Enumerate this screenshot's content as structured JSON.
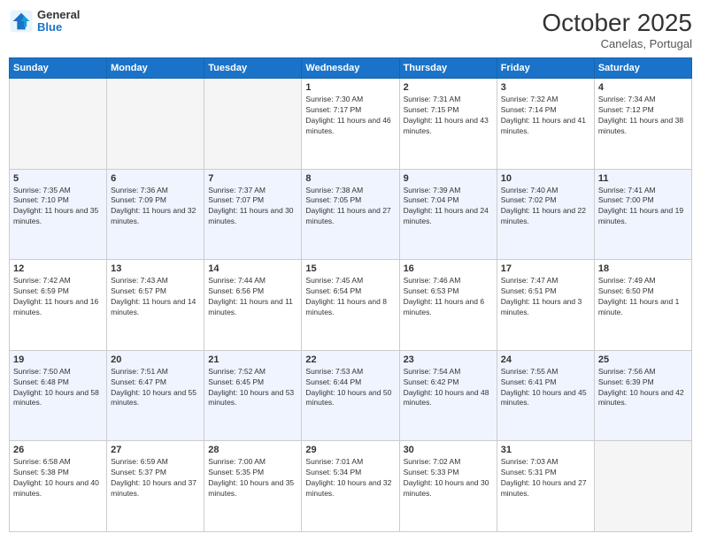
{
  "header": {
    "logo": {
      "general": "General",
      "blue": "Blue"
    },
    "title": "October 2025",
    "subtitle": "Canelas, Portugal"
  },
  "days_of_week": [
    "Sunday",
    "Monday",
    "Tuesday",
    "Wednesday",
    "Thursday",
    "Friday",
    "Saturday"
  ],
  "weeks": [
    [
      {
        "day": "",
        "empty": true
      },
      {
        "day": "",
        "empty": true
      },
      {
        "day": "",
        "empty": true
      },
      {
        "day": "1",
        "sunrise": "7:30 AM",
        "sunset": "7:17 PM",
        "daylight": "11 hours and 46 minutes."
      },
      {
        "day": "2",
        "sunrise": "7:31 AM",
        "sunset": "7:15 PM",
        "daylight": "11 hours and 43 minutes."
      },
      {
        "day": "3",
        "sunrise": "7:32 AM",
        "sunset": "7:14 PM",
        "daylight": "11 hours and 41 minutes."
      },
      {
        "day": "4",
        "sunrise": "7:34 AM",
        "sunset": "7:12 PM",
        "daylight": "11 hours and 38 minutes."
      }
    ],
    [
      {
        "day": "5",
        "sunrise": "7:35 AM",
        "sunset": "7:10 PM",
        "daylight": "11 hours and 35 minutes."
      },
      {
        "day": "6",
        "sunrise": "7:36 AM",
        "sunset": "7:09 PM",
        "daylight": "11 hours and 32 minutes."
      },
      {
        "day": "7",
        "sunrise": "7:37 AM",
        "sunset": "7:07 PM",
        "daylight": "11 hours and 30 minutes."
      },
      {
        "day": "8",
        "sunrise": "7:38 AM",
        "sunset": "7:05 PM",
        "daylight": "11 hours and 27 minutes."
      },
      {
        "day": "9",
        "sunrise": "7:39 AM",
        "sunset": "7:04 PM",
        "daylight": "11 hours and 24 minutes."
      },
      {
        "day": "10",
        "sunrise": "7:40 AM",
        "sunset": "7:02 PM",
        "daylight": "11 hours and 22 minutes."
      },
      {
        "day": "11",
        "sunrise": "7:41 AM",
        "sunset": "7:00 PM",
        "daylight": "11 hours and 19 minutes."
      }
    ],
    [
      {
        "day": "12",
        "sunrise": "7:42 AM",
        "sunset": "6:59 PM",
        "daylight": "11 hours and 16 minutes."
      },
      {
        "day": "13",
        "sunrise": "7:43 AM",
        "sunset": "6:57 PM",
        "daylight": "11 hours and 14 minutes."
      },
      {
        "day": "14",
        "sunrise": "7:44 AM",
        "sunset": "6:56 PM",
        "daylight": "11 hours and 11 minutes."
      },
      {
        "day": "15",
        "sunrise": "7:45 AM",
        "sunset": "6:54 PM",
        "daylight": "11 hours and 8 minutes."
      },
      {
        "day": "16",
        "sunrise": "7:46 AM",
        "sunset": "6:53 PM",
        "daylight": "11 hours and 6 minutes."
      },
      {
        "day": "17",
        "sunrise": "7:47 AM",
        "sunset": "6:51 PM",
        "daylight": "11 hours and 3 minutes."
      },
      {
        "day": "18",
        "sunrise": "7:49 AM",
        "sunset": "6:50 PM",
        "daylight": "11 hours and 1 minute."
      }
    ],
    [
      {
        "day": "19",
        "sunrise": "7:50 AM",
        "sunset": "6:48 PM",
        "daylight": "10 hours and 58 minutes."
      },
      {
        "day": "20",
        "sunrise": "7:51 AM",
        "sunset": "6:47 PM",
        "daylight": "10 hours and 55 minutes."
      },
      {
        "day": "21",
        "sunrise": "7:52 AM",
        "sunset": "6:45 PM",
        "daylight": "10 hours and 53 minutes."
      },
      {
        "day": "22",
        "sunrise": "7:53 AM",
        "sunset": "6:44 PM",
        "daylight": "10 hours and 50 minutes."
      },
      {
        "day": "23",
        "sunrise": "7:54 AM",
        "sunset": "6:42 PM",
        "daylight": "10 hours and 48 minutes."
      },
      {
        "day": "24",
        "sunrise": "7:55 AM",
        "sunset": "6:41 PM",
        "daylight": "10 hours and 45 minutes."
      },
      {
        "day": "25",
        "sunrise": "7:56 AM",
        "sunset": "6:39 PM",
        "daylight": "10 hours and 42 minutes."
      }
    ],
    [
      {
        "day": "26",
        "sunrise": "6:58 AM",
        "sunset": "5:38 PM",
        "daylight": "10 hours and 40 minutes."
      },
      {
        "day": "27",
        "sunrise": "6:59 AM",
        "sunset": "5:37 PM",
        "daylight": "10 hours and 37 minutes."
      },
      {
        "day": "28",
        "sunrise": "7:00 AM",
        "sunset": "5:35 PM",
        "daylight": "10 hours and 35 minutes."
      },
      {
        "day": "29",
        "sunrise": "7:01 AM",
        "sunset": "5:34 PM",
        "daylight": "10 hours and 32 minutes."
      },
      {
        "day": "30",
        "sunrise": "7:02 AM",
        "sunset": "5:33 PM",
        "daylight": "10 hours and 30 minutes."
      },
      {
        "day": "31",
        "sunrise": "7:03 AM",
        "sunset": "5:31 PM",
        "daylight": "10 hours and 27 minutes."
      },
      {
        "day": "",
        "empty": true
      }
    ]
  ]
}
